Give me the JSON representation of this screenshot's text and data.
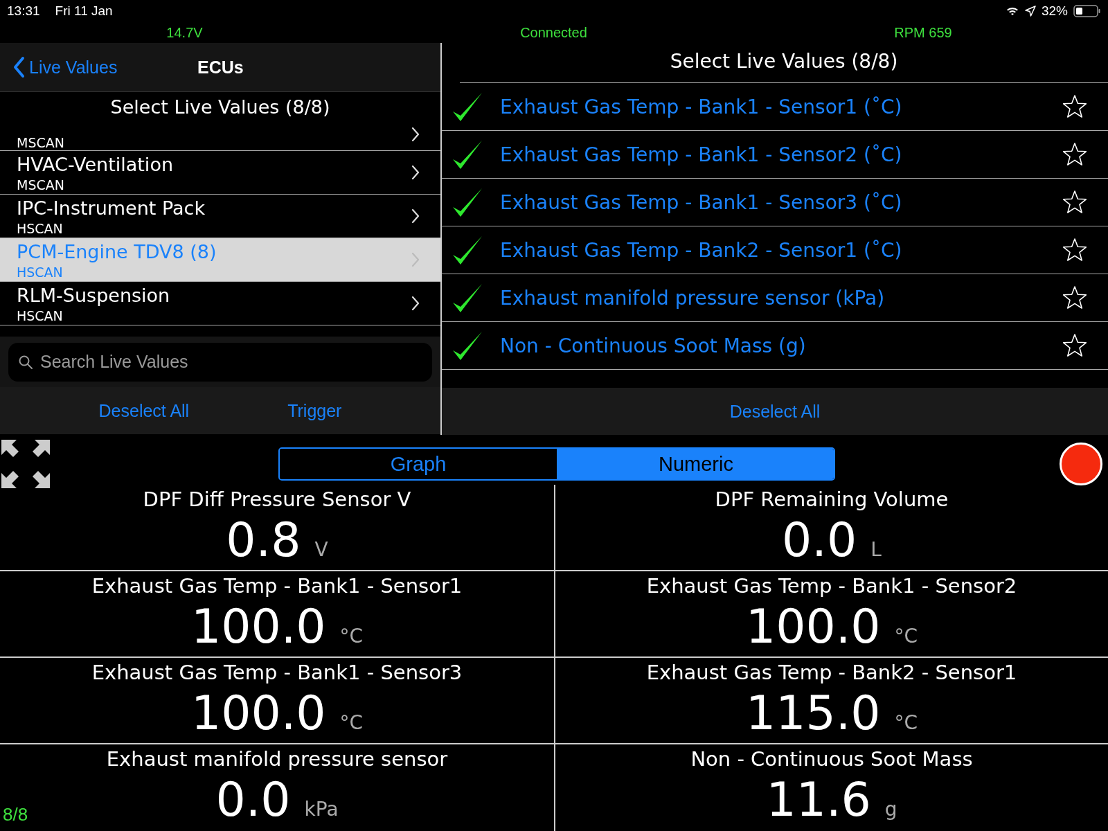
{
  "status_bar": {
    "time": "13:31",
    "date": "Fri 11 Jan",
    "battery": "32%"
  },
  "info_bar": {
    "voltage": "14.7V",
    "connection": "Connected",
    "rpm": "RPM 659"
  },
  "ecu_panel": {
    "back": "Live Values",
    "title": "ECUs",
    "header": "Select Live Values (8/8)",
    "items": [
      {
        "bus": "MSCAN",
        "selected": false
      },
      {
        "name": "HVAC-Ventilation",
        "bus": "MSCAN",
        "selected": false
      },
      {
        "name": "IPC-Instrument Pack",
        "bus": "HSCAN",
        "selected": false
      },
      {
        "name": "PCM-Engine TDV8 (8)",
        "bus": "HSCAN",
        "selected": true
      },
      {
        "name": "RLM-Suspension",
        "bus": "HSCAN",
        "selected": false
      }
    ],
    "search": {
      "placeholder": "Search Live Values"
    },
    "buttons": [
      "Deselect All",
      "Trigger"
    ]
  },
  "values_panel": {
    "title": "Select Live Values (8/8)",
    "items": [
      {
        "label": "Exhaust Gas Temp - Bank1 - Sensor1 (˚C)",
        "checked": true,
        "favorite": false
      },
      {
        "label": "Exhaust Gas Temp - Bank1 - Sensor2 (˚C)",
        "checked": true,
        "favorite": false
      },
      {
        "label": "Exhaust Gas Temp - Bank1 - Sensor3 (˚C)",
        "checked": true,
        "favorite": false
      },
      {
        "label": "Exhaust Gas Temp - Bank2 - Sensor1 (˚C)",
        "checked": true,
        "favorite": false
      },
      {
        "label": "Exhaust manifold pressure sensor (kPa)",
        "checked": true,
        "favorite": false
      },
      {
        "label": "Non - Continuous Soot Mass (g)",
        "checked": true,
        "favorite": false
      }
    ],
    "button": "Deselect All"
  },
  "view_tabs": [
    {
      "label": "Graph",
      "selected": false
    },
    {
      "label": "Numeric",
      "selected": true
    }
  ],
  "readings": [
    {
      "name": "DPF Diff Pressure Sensor V",
      "value": "0.8",
      "unit": "V"
    },
    {
      "name": "DPF Remaining Volume",
      "value": "0.0",
      "unit": "L"
    },
    {
      "name": "Exhaust Gas Temp - Bank1 - Sensor1",
      "value": "100.0",
      "unit": "°C"
    },
    {
      "name": "Exhaust Gas Temp - Bank1 - Sensor2",
      "value": "100.0",
      "unit": "°C"
    },
    {
      "name": "Exhaust Gas Temp - Bank1 - Sensor3",
      "value": "100.0",
      "unit": "°C"
    },
    {
      "name": "Exhaust Gas Temp - Bank2 - Sensor1",
      "value": "115.0",
      "unit": "°C"
    },
    {
      "name": "Exhaust manifold pressure sensor",
      "value": "0.0",
      "unit": "kPa"
    },
    {
      "name": "Non - Continuous Soot Mass",
      "value": "11.6",
      "unit": "g"
    }
  ],
  "page_counter": "8/8"
}
